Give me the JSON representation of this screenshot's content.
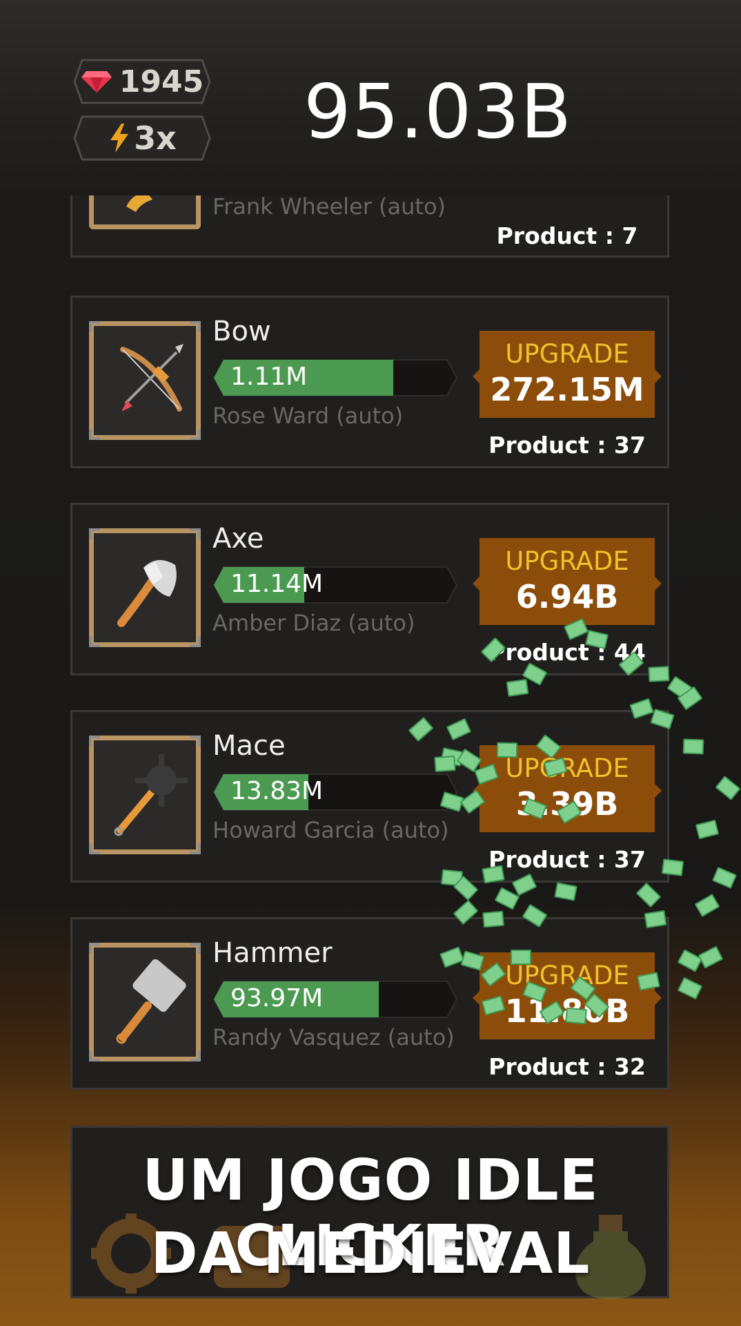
{
  "hud": {
    "gems": "1945",
    "boost": "3x",
    "money": "95.03B"
  },
  "partial_item": {
    "worker": "Frank Wheeler (auto)",
    "product": "Product : 7"
  },
  "items": [
    {
      "name": "Bow",
      "production": "1.11M",
      "progress": 0.82,
      "worker": "Rose Ward (auto)",
      "upgrade_label": "UPGRADE",
      "upgrade_price": "272.15M",
      "product": "Product : 37",
      "icon": "bow-icon"
    },
    {
      "name": "Axe",
      "production": "11.14M",
      "progress": 0.39,
      "worker": "Amber Diaz (auto)",
      "upgrade_label": "UPGRADE",
      "upgrade_price": "6.94B",
      "product": "Product : 44",
      "icon": "axe-icon"
    },
    {
      "name": "Mace",
      "production": "13.83M",
      "progress": 0.41,
      "worker": "Howard Garcia (auto)",
      "upgrade_label": "UPGRADE",
      "upgrade_price": "3.39B",
      "product": "Product : 37",
      "icon": "mace-icon"
    },
    {
      "name": "Hammer",
      "production": "93.97M",
      "progress": 0.75,
      "worker": "Randy Vasquez (auto)",
      "upgrade_label": "UPGRADE",
      "upgrade_price": "11.80B",
      "product": "Product : 32",
      "icon": "hammer-icon"
    }
  ],
  "promo": {
    "line1": "UM JOGO IDLE CLICKER",
    "line2": "DA MEDIEVAL"
  },
  "colors": {
    "bar_fill": "#4c9a52",
    "upgrade_bg": "#8c4d0a",
    "upgrade_label": "#f2c12c",
    "frame": "#b89563"
  }
}
